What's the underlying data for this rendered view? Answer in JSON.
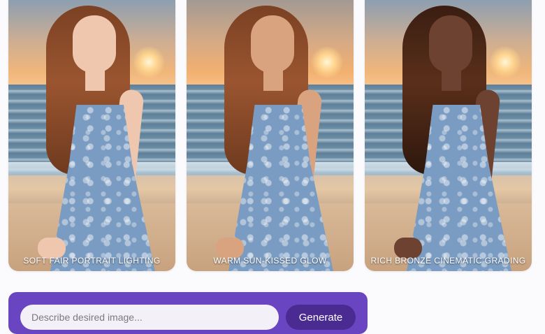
{
  "gallery": {
    "cards": [
      {
        "caption": "SOFT FAIR PORTRAIT LIGHTING"
      },
      {
        "caption": "WARM SUN-KISSED GLOW"
      },
      {
        "caption": "RICH BRONZE CINEMATIC GRADING"
      }
    ]
  },
  "prompt": {
    "placeholder": "Describe desired image...",
    "generate_label": "Generate"
  },
  "colors": {
    "accent": "#6a45c2",
    "button": "#4a2b91",
    "input_bg": "#f3f1f7"
  }
}
